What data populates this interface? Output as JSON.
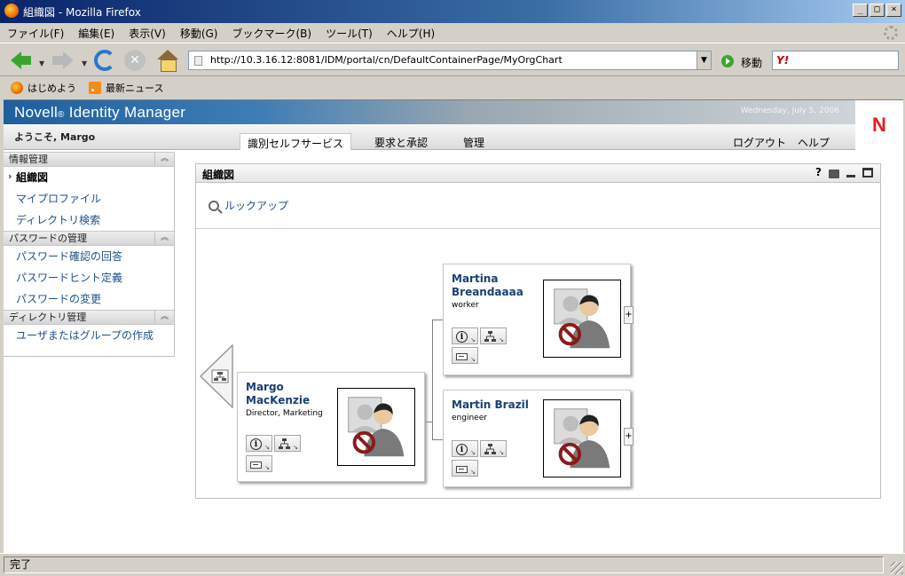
{
  "window": {
    "title": "組織図 - Mozilla Firefox",
    "controls": [
      "_",
      "□",
      "×"
    ]
  },
  "menubar": [
    "ファイル(F)",
    "編集(E)",
    "表示(V)",
    "移動(G)",
    "ブックマーク(B)",
    "ツール(T)",
    "ヘルプ(H)"
  ],
  "navbar": {
    "url": "http://10.3.16.12:8081/IDM/portal/cn/DefaultContainerPage/MyOrgChart",
    "go_label": "移動",
    "search_engine": "Y!"
  },
  "bookmarks": [
    "はじめよう",
    "最新ニュース"
  ],
  "portal": {
    "product": "Novell",
    "product_mark": "®",
    "app": "Identity Manager",
    "date": "Wednesday, July 5, 2006",
    "logo": "N",
    "welcome": "ようこそ, Margo",
    "tabs": [
      "識別セルフサービス",
      "要求と承認",
      "管理"
    ],
    "top_links": [
      "ログアウト",
      "ヘルプ"
    ]
  },
  "sidebar": {
    "sections": [
      {
        "title": "情報管理",
        "items": [
          "組織図",
          "マイプロファイル",
          "ディレクトリ検索"
        ]
      },
      {
        "title": "パスワードの管理",
        "items": [
          "パスワード確認の回答",
          "パスワードヒント定義",
          "パスワードの変更"
        ]
      },
      {
        "title": "ディレクトリ管理",
        "items": [
          "ユーザまたはグループの作成"
        ]
      }
    ],
    "selected": "組織図"
  },
  "portlet": {
    "title": "組織図",
    "help": "?",
    "lookup_label": "ルックアップ",
    "people": {
      "manager": {
        "name_line1": "Margo",
        "name_line2": "MacKenzie",
        "title": "Director, Marketing"
      },
      "report1": {
        "name_line1": "Martina",
        "name_line2": "Breandaaaa",
        "title": "worker"
      },
      "report2": {
        "name_line1": "Martin Brazil",
        "name_line2": "",
        "title": "engineer"
      }
    },
    "expand": "+"
  },
  "status": "完了",
  "colors": {
    "link": "#1f4f8a",
    "name": "#1a3f73",
    "novell_red": "#e51c23",
    "banner": "#1f5f9c"
  }
}
